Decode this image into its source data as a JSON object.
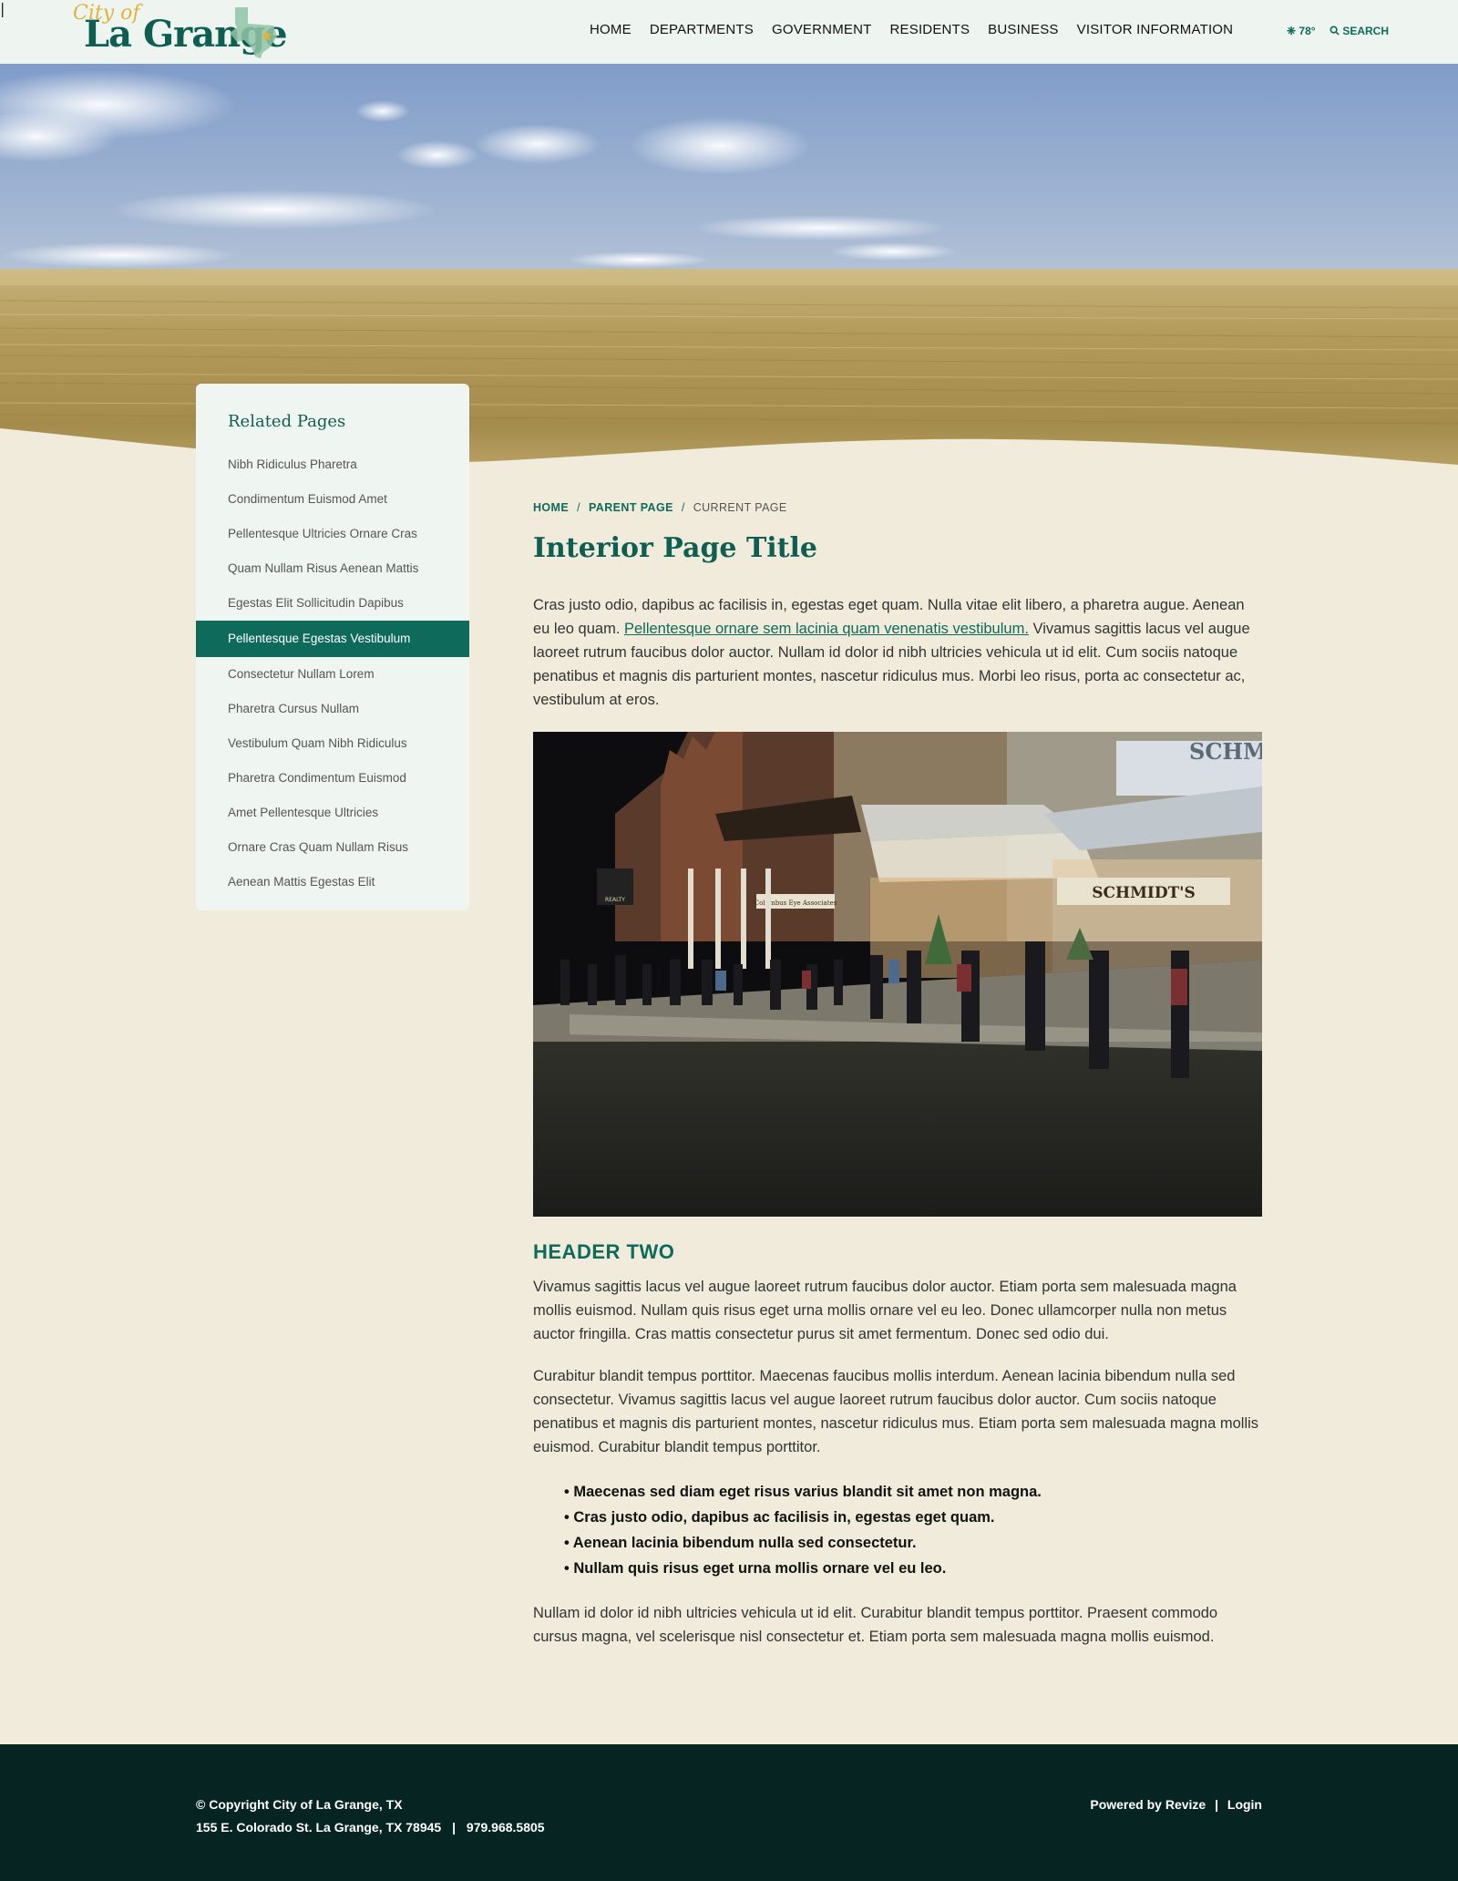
{
  "site": {
    "logo_top": "City of",
    "logo_name": "La Grange"
  },
  "nav": {
    "items": [
      "HOME",
      "DEPARTMENTS",
      "GOVERNMENT",
      "RESIDENTS",
      "BUSINESS",
      "VISITOR INFORMATION"
    ],
    "separator": "|",
    "weather": "78°",
    "weather_icon": "sun-icon",
    "search_label": "SEARCH",
    "search_icon": "search-icon"
  },
  "sidebar": {
    "title": "Related Pages",
    "items": [
      "Nibh Ridiculus Pharetra",
      "Condimentum Euismod Amet",
      "Pellentesque Ultricies Ornare Cras",
      "Quam Nullam Risus Aenean Mattis",
      "Egestas Elit Sollicitudin Dapibus",
      "Pellentesque Egestas Vestibulum",
      "Consectetur Nullam Lorem",
      "Pharetra Cursus Nullam",
      "Vestibulum Quam Nibh Ridiculus",
      "Pharetra Condimentum Euismod",
      "Amet Pellentesque Ultricies",
      "Ornare Cras Quam Nullam Risus",
      "Aenean Mattis Egestas Elit"
    ],
    "active_index": 5
  },
  "breadcrumb": {
    "home": "HOME",
    "parent": "PARENT PAGE",
    "current": "CURRENT PAGE",
    "separator": "/"
  },
  "content": {
    "title": "Interior Page Title",
    "intro_before_link": "Cras justo odio, dapibus ac facilisis in, egestas eget quam. Nulla vitae elit libero, a pharetra augue. Aenean eu leo quam. ",
    "intro_link": "Pellentesque ornare sem lacinia quam venenatis vestibulum.",
    "intro_after_link": " Vivamus sagittis lacus vel augue laoreet rutrum faucibus dolor auctor. Nullam id dolor id nibh ultricies vehicula ut id elit. Cum sociis natoque penatibus et magnis dis parturient montes, nascetur ridiculus mus. Morbi leo risus, porta ac consectetur ac, vestibulum at eros.",
    "header_two": "HEADER TWO",
    "para2": "Vivamus sagittis lacus vel augue laoreet rutrum faucibus dolor auctor. Etiam porta sem malesuada magna mollis euismod. Nullam quis risus eget urna mollis ornare vel eu leo. Donec ullamcorper nulla non metus auctor fringilla. Cras mattis consectetur purus sit amet fermentum. Donec sed odio dui.",
    "para3": "Curabitur blandit tempus porttitor. Maecenas faucibus mollis interdum. Aenean lacinia bibendum nulla sed consectetur. Vivamus sagittis lacus vel augue laoreet rutrum faucibus dolor auctor. Cum sociis natoque penatibus et magnis dis parturient montes, nascetur ridiculus mus. Etiam porta sem malesuada magna mollis euismod. Curabitur blandit tempus porttitor.",
    "bullets": [
      "Maecenas sed diam eget risus varius blandit sit amet non magna.",
      "Cras justo odio, dapibus ac facilisis in, egestas eget quam.",
      "Aenean lacinia bibendum nulla sed consectetur.",
      "Nullam quis risus eget urna mollis ornare vel eu leo."
    ],
    "para4": "Nullam id dolor id nibh ultricies vehicula ut id elit. Curabitur blandit tempus porttitor. Praesent commodo cursus magna, vel scelerisque nisl consectetur et. Etiam porta sem malesuada magna mollis euismod.",
    "photo_signs": [
      "SCHMIDT'S",
      "SCHMID",
      "Columbus Eye Associates",
      "REALTY"
    ]
  },
  "footer": {
    "copyright": "© Copyright City of La Grange, TX",
    "address": "155 E. Colorado St. La Grange, TX 78945",
    "divider": "|",
    "phone": "979.968.5805",
    "powered": "Powered by Revize",
    "login": "Login"
  },
  "colors": {
    "brand_green": "#0e6b5c",
    "header_bg": "#eef4ef",
    "page_bg": "#f0ebdb",
    "footer_bg": "#062422",
    "logo_gold": "#e0b43a"
  }
}
